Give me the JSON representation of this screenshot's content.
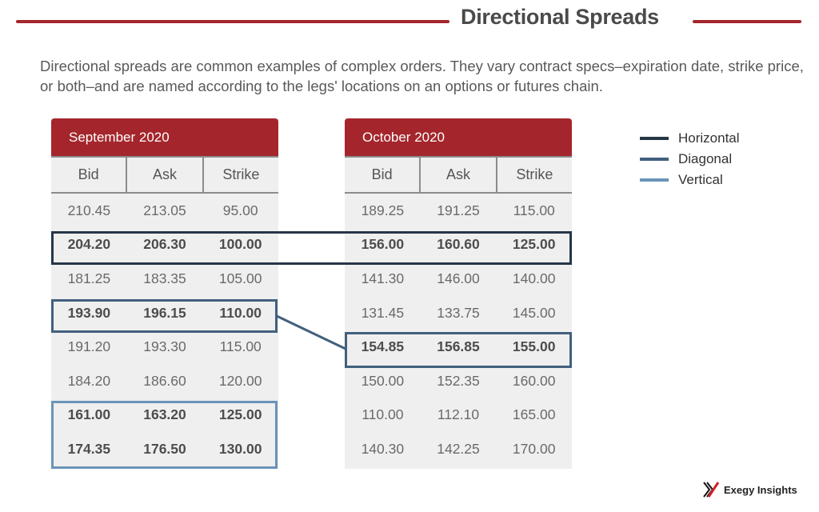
{
  "header": {
    "title": "Directional Spreads",
    "accent_color": "#a4262c"
  },
  "intro": "Directional spreads are common examples of complex orders. They vary contract specs–expiration date, strike price, or both–and are named according to the legs' locations on an options or futures chain.",
  "columns": [
    "Bid",
    "Ask",
    "Strike"
  ],
  "tables": [
    {
      "title": "September 2020",
      "rows": [
        {
          "bid": "210.45",
          "ask": "213.05",
          "strike": "95.00",
          "bold": false
        },
        {
          "bid": "204.20",
          "ask": "206.30",
          "strike": "100.00",
          "bold": true
        },
        {
          "bid": "181.25",
          "ask": "183.35",
          "strike": "105.00",
          "bold": false
        },
        {
          "bid": "193.90",
          "ask": "196.15",
          "strike": "110.00",
          "bold": true
        },
        {
          "bid": "191.20",
          "ask": "193.30",
          "strike": "115.00",
          "bold": false
        },
        {
          "bid": "184.20",
          "ask": "186.60",
          "strike": "120.00",
          "bold": false
        },
        {
          "bid": "161.00",
          "ask": "163.20",
          "strike": "125.00",
          "bold": true
        },
        {
          "bid": "174.35",
          "ask": "176.50",
          "strike": "130.00",
          "bold": true
        }
      ]
    },
    {
      "title": "October 2020",
      "rows": [
        {
          "bid": "189.25",
          "ask": "191.25",
          "strike": "115.00",
          "bold": false
        },
        {
          "bid": "156.00",
          "ask": "160.60",
          "strike": "125.00",
          "bold": true
        },
        {
          "bid": "141.30",
          "ask": "146.00",
          "strike": "140.00",
          "bold": false
        },
        {
          "bid": "131.45",
          "ask": "133.75",
          "strike": "145.00",
          "bold": false
        },
        {
          "bid": "154.85",
          "ask": "156.85",
          "strike": "155.00",
          "bold": true
        },
        {
          "bid": "150.00",
          "ask": "152.35",
          "strike": "160.00",
          "bold": false
        },
        {
          "bid": "110.00",
          "ask": "112.10",
          "strike": "165.00",
          "bold": false
        },
        {
          "bid": "140.30",
          "ask": "142.25",
          "strike": "170.00",
          "bold": false
        }
      ]
    }
  ],
  "legend": [
    {
      "label": "Horizontal",
      "color": "#263646"
    },
    {
      "label": "Diagonal",
      "color": "#42607e"
    },
    {
      "label": "Vertical",
      "color": "#6a93b8"
    }
  ],
  "spreads": {
    "horizontal": "September 2020 100.00 strike ↔ October 2020 125.00 strike",
    "diagonal": "September 2020 110.00 strike ↔ October 2020 155.00 strike",
    "vertical": "September 2020 125.00 strike + 130.00 strike"
  },
  "logo": {
    "text": "Exegy Insights",
    "icon": "exegy-x-logo-icon"
  }
}
